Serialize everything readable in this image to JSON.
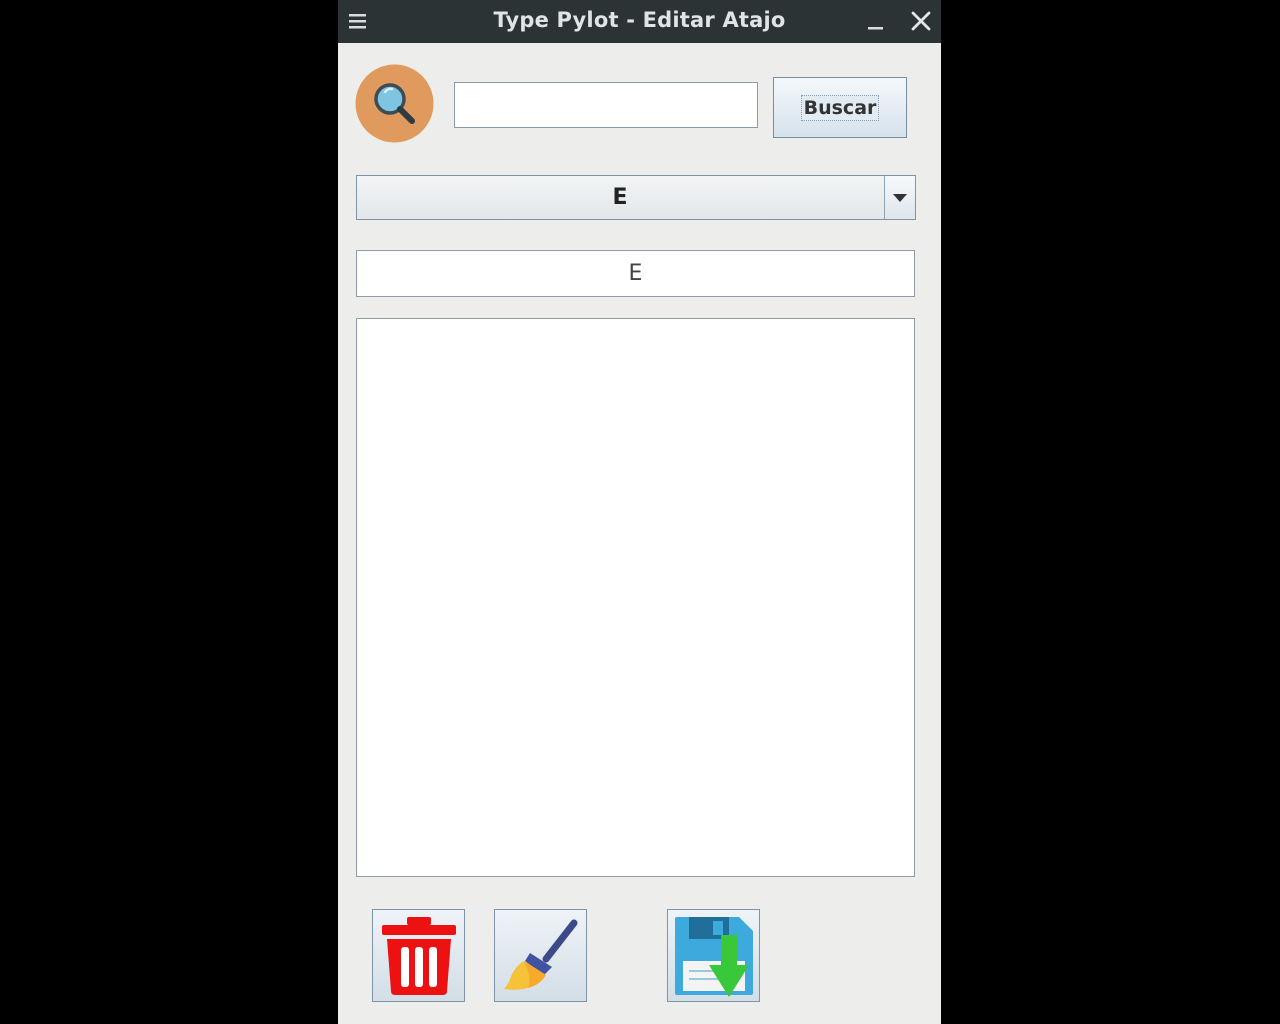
{
  "window": {
    "title": "Type Pylot - Editar Atajo",
    "menu_icon": "hamburger-menu-icon",
    "minimize_icon": "minimize-icon",
    "close_icon": "close-icon"
  },
  "search": {
    "icon": "magnifier-icon",
    "value": "",
    "button_label": "Buscar"
  },
  "shortcut_select": {
    "selected": "E"
  },
  "shortcut_name": {
    "value": "E"
  },
  "content": {
    "text": ""
  },
  "toolbar": {
    "delete_icon": "trash-icon",
    "clean_icon": "broom-icon",
    "save_icon": "floppy-save-icon"
  },
  "colors": {
    "titlebar": "#2b3335",
    "window_bg": "#ededeb",
    "search_circle": "#e09a5d",
    "trash": "#ee1111",
    "save_arrow": "#39c83a"
  }
}
